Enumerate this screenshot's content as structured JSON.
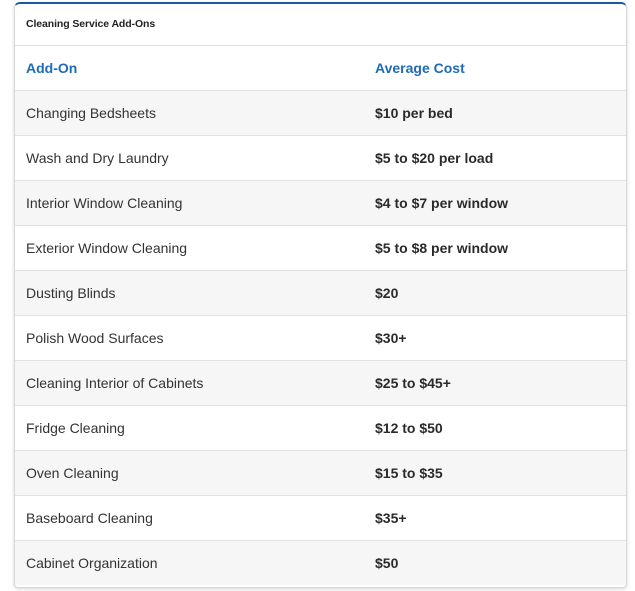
{
  "table": {
    "caption": "Cleaning Service Add-Ons",
    "headers": [
      "Add-On",
      "Average Cost"
    ],
    "rows": [
      {
        "addon": "Changing Bedsheets",
        "cost": "$10 per bed"
      },
      {
        "addon": "Wash and Dry Laundry",
        "cost": "$5 to $20 per load"
      },
      {
        "addon": "Interior Window Cleaning",
        "cost": "$4 to $7 per window"
      },
      {
        "addon": "Exterior Window Cleaning",
        "cost": "$5 to $8 per window"
      },
      {
        "addon": "Dusting Blinds",
        "cost": "$20"
      },
      {
        "addon": "Polish Wood Surfaces",
        "cost": "$30+"
      },
      {
        "addon": "Cleaning Interior of Cabinets",
        "cost": "$25 to $45+"
      },
      {
        "addon": "Fridge Cleaning",
        "cost": "$12 to $50"
      },
      {
        "addon": "Oven Cleaning",
        "cost": "$15 to $35"
      },
      {
        "addon": "Baseboard Cleaning",
        "cost": "$35+"
      },
      {
        "addon": "Cabinet Organization",
        "cost": "$50"
      }
    ]
  },
  "colors": {
    "header_text": "#1e6bb8",
    "top_border": "#1c5aa0",
    "stripe": "#f6f6f6"
  }
}
